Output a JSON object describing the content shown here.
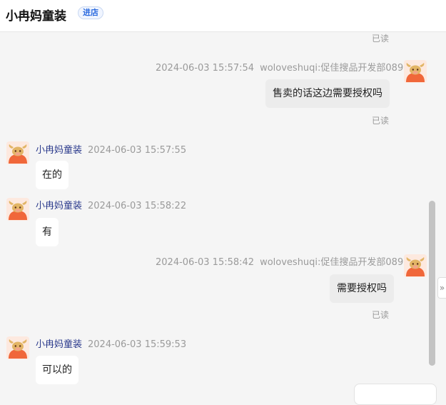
{
  "header": {
    "shop_name": "小冉妈童装",
    "enter_badge": "进店"
  },
  "read_label": "已读",
  "messages": [
    {
      "direction": "out",
      "time": "2024-06-03 15:57:54",
      "sender": "woloveshuqi:促佳搜品开发部089",
      "text": "售卖的话这边需要授权吗"
    },
    {
      "direction": "in",
      "sender": "小冉妈童装",
      "time": "2024-06-03 15:57:55",
      "text": "在的"
    },
    {
      "direction": "in",
      "sender": "小冉妈童装",
      "time": "2024-06-03 15:58:22",
      "text": "有"
    },
    {
      "direction": "out",
      "time": "2024-06-03 15:58:42",
      "sender": "woloveshuqi:促佳搜品开发部089",
      "text": "需要授权吗"
    },
    {
      "direction": "in",
      "sender": "小冉妈童装",
      "time": "2024-06-03 15:59:53",
      "text": "可以的"
    }
  ],
  "side_tab_icon": "double-chevron-right-icon",
  "side_tab_glyph": "»",
  "colors": {
    "accent_blue": "#2d6cdf",
    "shop_name_blue": "#2b3a8c",
    "avatar_orange": "#f0673a",
    "avatar_tan": "#e2b565"
  }
}
